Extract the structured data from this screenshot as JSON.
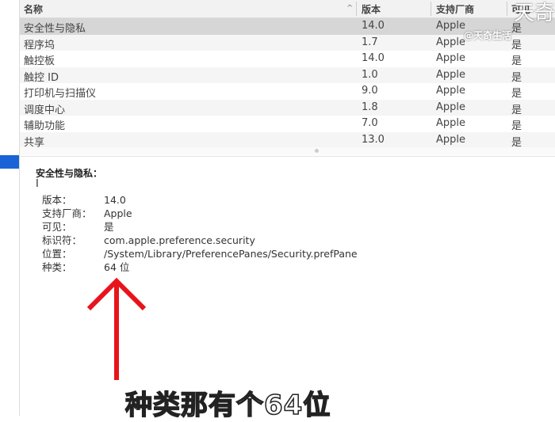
{
  "table": {
    "headers": [
      "名称",
      "版本",
      "支持厂商",
      "可见"
    ],
    "rows": [
      {
        "name": "安全性与隐私",
        "version": "14.0",
        "vendor": "Apple",
        "visible": "是"
      },
      {
        "name": "程序坞",
        "version": "1.7",
        "vendor": "Apple",
        "visible": "是"
      },
      {
        "name": "触控板",
        "version": "14.0",
        "vendor": "Apple",
        "visible": "是"
      },
      {
        "name": "触控 ID",
        "version": "1.0",
        "vendor": "Apple",
        "visible": "是"
      },
      {
        "name": "打印机与扫描仪",
        "version": "9.0",
        "vendor": "Apple",
        "visible": "是"
      },
      {
        "name": "调度中心",
        "version": "1.8",
        "vendor": "Apple",
        "visible": "是"
      },
      {
        "name": "辅助功能",
        "version": "7.0",
        "vendor": "Apple",
        "visible": "是"
      },
      {
        "name": "共享",
        "version": "13.0",
        "vendor": "Apple",
        "visible": "是"
      }
    ],
    "sort_icon": "chevron-up-icon"
  },
  "detail": {
    "title": "安全性与隐私：",
    "fields": [
      {
        "k": "版本：",
        "v": "14.0"
      },
      {
        "k": "支持厂商：",
        "v": "Apple"
      },
      {
        "k": "可见：",
        "v": "是"
      },
      {
        "k": "标识符：",
        "v": "com.apple.preference.security"
      },
      {
        "k": "位置：",
        "v": "/System/Library/PreferencePanes/Security.prefPane"
      },
      {
        "k": "种类：",
        "v": "64 位"
      }
    ]
  },
  "watermark": {
    "top": "天奇",
    "handle": "@天奇生活"
  },
  "caption": "种类那有个64位",
  "colors": {
    "selection": "#1a63d6",
    "arrow": "#e8141b"
  }
}
